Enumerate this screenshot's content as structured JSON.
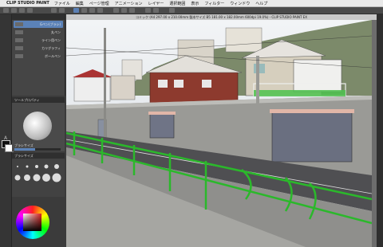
{
  "menubar": {
    "app": "CLIP STUDIO PAINT",
    "items": [
      "ファイル",
      "編集",
      "ページ管理",
      "アニメーション",
      "レイヤー",
      "選択範囲",
      "表示",
      "フィルター",
      "ウィンドウ",
      "ヘルプ"
    ]
  },
  "document": {
    "title": "コミック (A4 297.00 x 210.00mm 製本サイズ B5 181.00 x 182.00mm 600dpi 19.0%) - CLIP STUDIO PAINT EX"
  },
  "sub_tool": {
    "items": [
      {
        "label": "Gペン(ブラシ)",
        "active": true
      },
      {
        "label": "丸ペン",
        "active": false
      },
      {
        "label": "ライン用ペン",
        "active": false
      },
      {
        "label": "カリグラフィ",
        "active": false
      },
      {
        "label": "ボールペン",
        "active": false
      }
    ]
  },
  "tool_property": {
    "header": "ツールプロパティ",
    "brush_size_label": "ブラシサイズ",
    "anti_alias_label": "アンチエイリアス"
  },
  "brush_size": {
    "header": "ブラシサイズ"
  },
  "colors": {
    "accent": "#5b82b8",
    "fence_green": "#2bb82b",
    "main_color": "#111111",
    "sub_color": "#ffffff"
  }
}
